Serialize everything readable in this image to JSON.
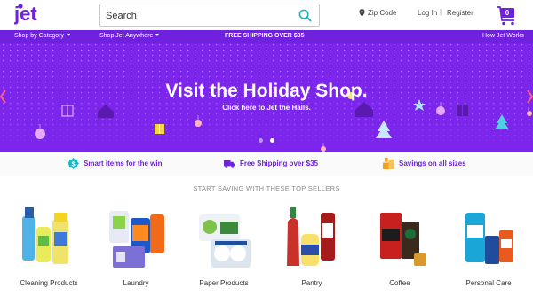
{
  "header": {
    "logo_text": "jet",
    "search_placeholder": "Search",
    "zip_label": "Zip Code",
    "login_label": "Log In",
    "separator": "|",
    "register_label": "Register",
    "cart_count": "0"
  },
  "nav": {
    "category_label": "Shop by Category",
    "anywhere_label": "Shop Jet Anywhere",
    "shipping_label": "FREE SHIPPING OVER $35",
    "how_label": "How Jet Works"
  },
  "hero": {
    "title": "Visit the Holiday Shop.",
    "subtitle": "Click here to Jet the Halls.",
    "slide_count": 2,
    "active_slide": 2
  },
  "props": [
    {
      "label": "Smart items for the win",
      "icon": "dollar-badge-icon",
      "color": "#1fb5c4"
    },
    {
      "label": "Free Shipping over $35",
      "icon": "truck-icon",
      "color": "#6e22dd"
    },
    {
      "label": "Savings on all sizes",
      "icon": "boxes-icon",
      "color": "#f2a31b"
    }
  ],
  "sellers": {
    "title": "START SAVING WITH THESE TOP SELLERS",
    "items": [
      {
        "label": "Cleaning Products"
      },
      {
        "label": "Laundry"
      },
      {
        "label": "Paper Products"
      },
      {
        "label": "Pantry"
      },
      {
        "label": "Coffee"
      },
      {
        "label": "Personal Care"
      }
    ]
  },
  "colors": {
    "brand_purple": "#6e22dd",
    "hero_purple": "#7b26ea",
    "search_teal": "#1fb5c4"
  }
}
